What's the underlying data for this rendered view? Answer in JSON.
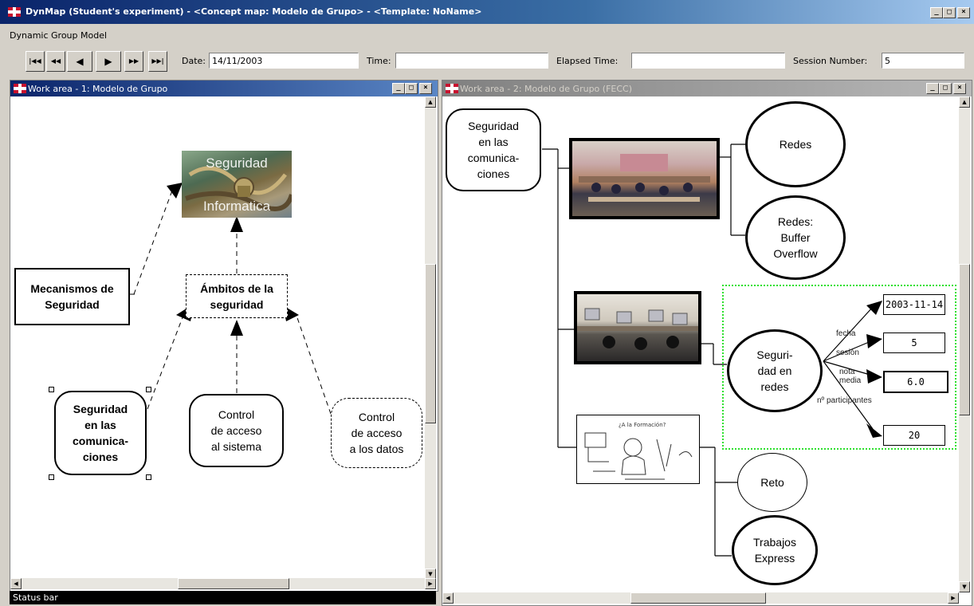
{
  "app": {
    "title": "DynMap (Student's experiment) - <Concept map: Modelo de Grupo> - <Template: NoName>",
    "menu": "Dynamic Group Model"
  },
  "toolbar": {
    "nav": [
      "first",
      "rewind",
      "step-back",
      "step-forward",
      "fast-forward",
      "last"
    ],
    "date_label": "Date:",
    "date_value": "14/11/2003",
    "time_label": "Time:",
    "time_value": "",
    "elapsed_label": "Elapsed Time:",
    "elapsed_value": "",
    "session_label": "Session Number:",
    "session_value": "5"
  },
  "window_controls": {
    "minimize": "_",
    "maximize": "□",
    "close": "×"
  },
  "left_window": {
    "title": "Work area - 1: Modelo de Grupo",
    "nodes": {
      "seguridad_informatica": {
        "top": "Seguridad",
        "bottom": "Informatica"
      },
      "mecanismos": "Mecanismos de\nSeguridad",
      "ambitos": "Ámbitos de la\nseguridad",
      "seguridad_com": "Seguridad\nen las\ncomunica-\nciones",
      "control_sistema": "Control\nde acceso\nal sistema",
      "control_datos": "Control\nde acceso\na los datos"
    }
  },
  "right_window": {
    "title": "Work area - 2: Modelo de Grupo (FECC)",
    "nodes": {
      "seguridad_com": "Seguridad\nen las\ncomunica-\nciones",
      "redes": "Redes",
      "buffer": "Redes:\nBuffer\nOverflow",
      "seguridad_redes": "Seguri-\ndad en\nredes",
      "reto": "Reto",
      "trabajos": "Trabajos\nExpress"
    },
    "attributes": [
      {
        "label": "fecha",
        "value": "2003-11-14"
      },
      {
        "label": "sesión",
        "value": "5"
      },
      {
        "label": "nota media",
        "value": "6.0"
      },
      {
        "label": "nº participantes",
        "value": "20"
      }
    ],
    "sketch_caption": "¿A la Formación?"
  },
  "status_bar": "Status bar"
}
